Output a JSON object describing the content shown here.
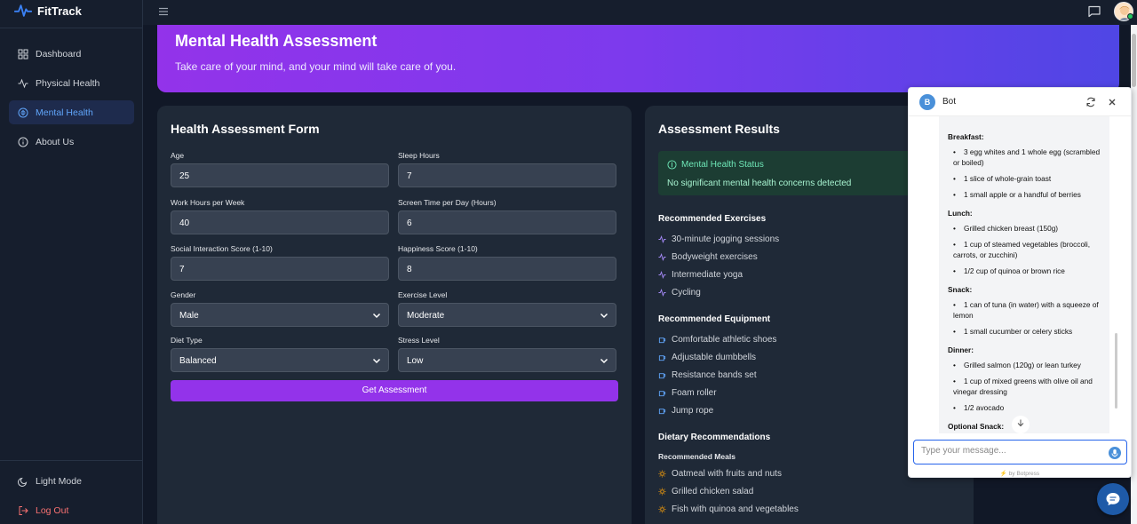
{
  "app": {
    "name": "FitTrack"
  },
  "sidebar": {
    "items": [
      {
        "label": "Dashboard",
        "icon": "grid-icon"
      },
      {
        "label": "Physical Health",
        "icon": "activity-icon"
      },
      {
        "label": "Mental Health",
        "icon": "brain-icon",
        "active": true
      },
      {
        "label": "About Us",
        "icon": "info-icon"
      }
    ],
    "light_mode": "Light Mode",
    "logout": "Log Out"
  },
  "banner": {
    "title": "Mental Health Assessment",
    "subtitle": "Take care of your mind, and your mind will take care of you."
  },
  "form": {
    "title": "Health Assessment Form",
    "fields": {
      "age": {
        "label": "Age",
        "value": "25"
      },
      "sleep": {
        "label": "Sleep Hours",
        "value": "7"
      },
      "work": {
        "label": "Work Hours per Week",
        "value": "40"
      },
      "screen": {
        "label": "Screen Time per Day (Hours)",
        "value": "6"
      },
      "social": {
        "label": "Social Interaction Score (1-10)",
        "value": "7"
      },
      "happiness": {
        "label": "Happiness Score (1-10)",
        "value": "8"
      },
      "gender": {
        "label": "Gender",
        "value": "Male"
      },
      "exercise": {
        "label": "Exercise Level",
        "value": "Moderate"
      },
      "diet": {
        "label": "Diet Type",
        "value": "Balanced"
      },
      "stress": {
        "label": "Stress Level",
        "value": "Low"
      }
    },
    "submit": "Get Assessment"
  },
  "results": {
    "title": "Assessment Results",
    "status_title": "Mental Health Status",
    "status_text": "No significant mental health concerns detected",
    "exercises_title": "Recommended Exercises",
    "exercises": [
      "30-minute jogging sessions",
      "Bodyweight exercises",
      "Intermediate yoga",
      "Cycling"
    ],
    "equipment_title": "Recommended Equipment",
    "equipment": [
      "Comfortable athletic shoes",
      "Adjustable dumbbells",
      "Resistance bands set",
      "Foam roller",
      "Jump rope"
    ],
    "diet_title": "Dietary Recommendations",
    "meals_title": "Recommended Meals",
    "meals": [
      "Oatmeal with fruits and nuts",
      "Grilled chicken salad",
      "Fish with quinoa and vegetables"
    ]
  },
  "chat": {
    "bot_initial": "B",
    "bot_name": "Bot",
    "breakfast": "Breakfast:",
    "breakfast_items": [
      "3 egg whites and 1 whole egg (scrambled or boiled)",
      "1 slice of whole-grain toast",
      "1 small apple or a handful of berries"
    ],
    "lunch": "Lunch:",
    "lunch_items": [
      "Grilled chicken breast (150g)",
      "1 cup of steamed vegetables (broccoli, carrots, or zucchini)",
      "1/2 cup of quinoa or brown rice"
    ],
    "snack": "Snack:",
    "snack_items": [
      "1 can of tuna (in water) with a squeeze of lemon",
      "1 small cucumber or celery sticks"
    ],
    "dinner": "Dinner:",
    "dinner_items": [
      "Grilled salmon (120g) or lean turkey",
      "1 cup of mixed greens with olive oil and vinegar dressing",
      "1/2 avocado"
    ],
    "optional": "Optional Snack:",
    "input_placeholder": "Type your message...",
    "powered_by": "⚡ by Botpress"
  }
}
